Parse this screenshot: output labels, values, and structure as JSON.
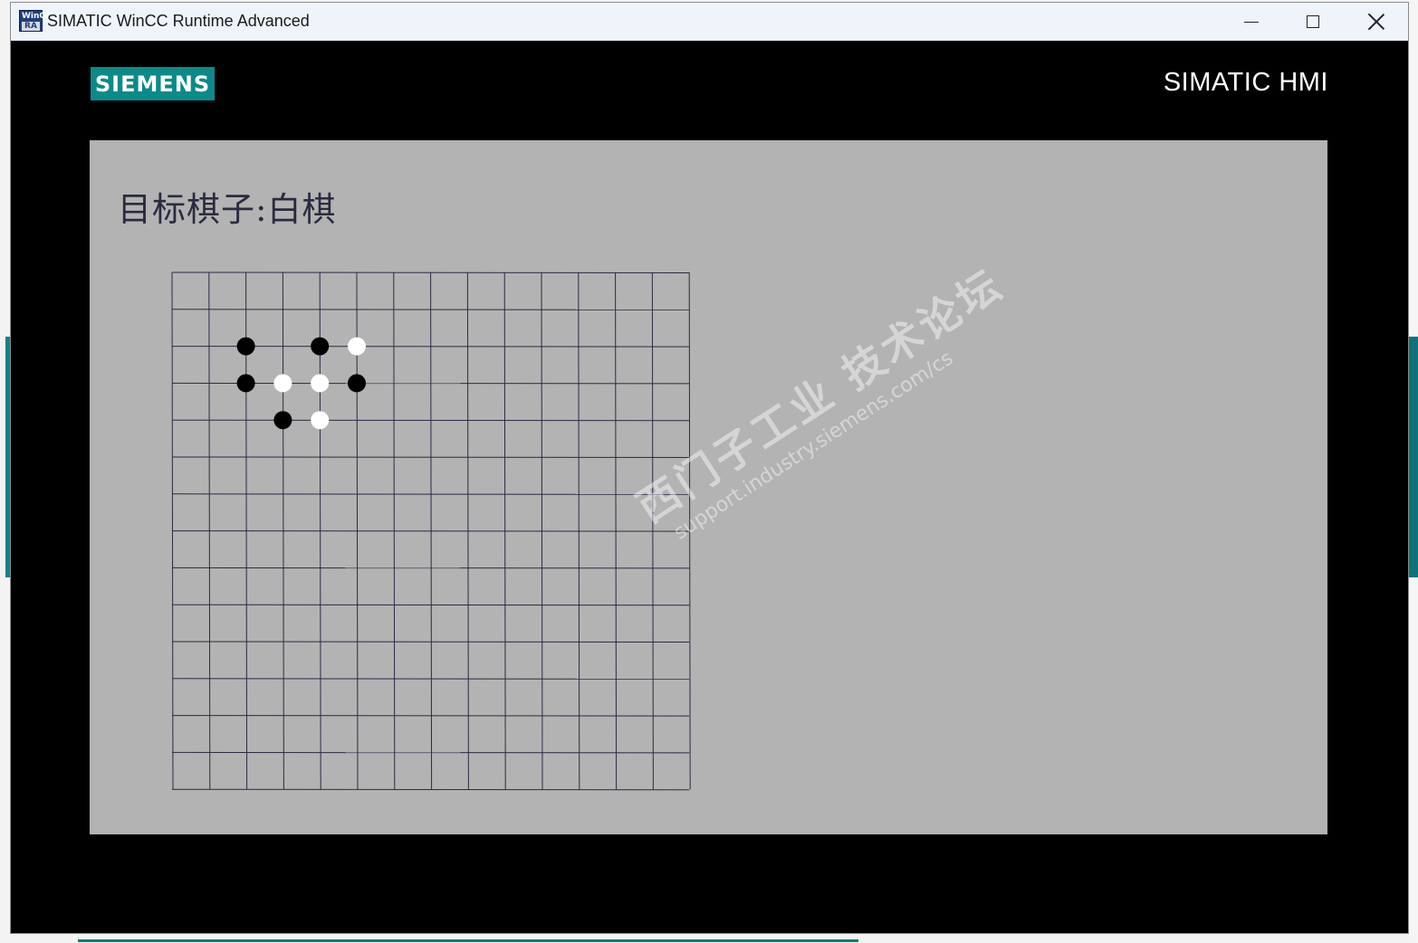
{
  "window": {
    "title": "SIMATIC WinCC Runtime Advanced",
    "icon_top": "WinCC",
    "icon_bottom": "RA"
  },
  "header": {
    "logo": "SIEMENS",
    "hmi_label": "SIMATIC HMI"
  },
  "screen": {
    "heading": "目标棋子:白棋"
  },
  "board": {
    "columns": 14,
    "rows": 14,
    "stones": [
      {
        "col": 2,
        "row": 2,
        "color": "black"
      },
      {
        "col": 4,
        "row": 2,
        "color": "black"
      },
      {
        "col": 5,
        "row": 2,
        "color": "white"
      },
      {
        "col": 2,
        "row": 3,
        "color": "black"
      },
      {
        "col": 3,
        "row": 3,
        "color": "white"
      },
      {
        "col": 4,
        "row": 3,
        "color": "white"
      },
      {
        "col": 5,
        "row": 3,
        "color": "black"
      },
      {
        "col": 3,
        "row": 4,
        "color": "black"
      },
      {
        "col": 4,
        "row": 4,
        "color": "white"
      }
    ]
  },
  "watermark": {
    "line1": "西门子工业 技术论坛",
    "line2": "support.industry.siemens.com/cs"
  },
  "colors": {
    "screen_bg": "#b3b3b3",
    "grid_line": "#2a2a45",
    "logo_bg": "#0c8a8a",
    "frame": "#000000"
  }
}
